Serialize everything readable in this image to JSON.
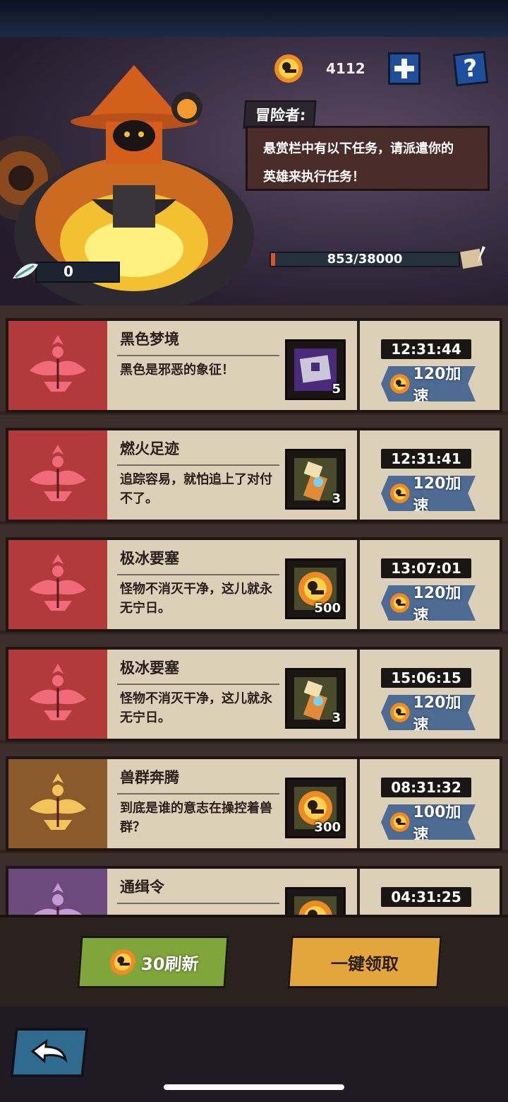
{
  "header": {
    "currency": {
      "icon": "gold-coin-icon",
      "value": "4112"
    },
    "plus_icon": "plus-icon",
    "help_label": "?"
  },
  "npc": {
    "name": "冒险者:",
    "line1": "悬赏栏中有以下任务，请派遣你的",
    "line2": "英雄来执行任务！"
  },
  "progress": {
    "text": "853/38000",
    "fraction": 0.022
  },
  "counter": {
    "icon": "feather-icon",
    "value": "0"
  },
  "tasks": [
    {
      "title": "黑色梦境",
      "desc": "黑色是邪恶的象征！",
      "reward_icon": "purple-box-icon",
      "reward_count": "5",
      "timer": "12:31:44",
      "speed_label": "120加速",
      "tier": "red"
    },
    {
      "title": "燃火足迹",
      "desc": "追踪容易，就怕追上了对付不了。",
      "reward_icon": "scroll-key-icon",
      "reward_count": "3",
      "timer": "12:31:41",
      "speed_label": "120加速",
      "tier": "red"
    },
    {
      "title": "极冰要塞",
      "desc": "怪物不消灭干净，这儿就永无宁日。",
      "reward_icon": "gold-coin-icon",
      "reward_count": "500",
      "timer": "13:07:01",
      "speed_label": "120加速",
      "tier": "red"
    },
    {
      "title": "极冰要塞",
      "desc": "怪物不消灭干净，这儿就永无宁日。",
      "reward_icon": "scroll-key-icon",
      "reward_count": "3",
      "timer": "15:06:15",
      "speed_label": "120加速",
      "tier": "red"
    },
    {
      "title": "兽群奔腾",
      "desc": "到底是谁的意志在操控着兽群？",
      "reward_icon": "gold-coin-icon",
      "reward_count": "300",
      "timer": "08:31:32",
      "speed_label": "100加速",
      "tier": "gold"
    },
    {
      "title": "通缉令",
      "desc": "",
      "reward_icon": "gold-coin-icon",
      "reward_count": "",
      "timer": "04:31:25",
      "speed_label": "",
      "tier": "purple"
    }
  ],
  "actions": {
    "refresh_label": "30刷新",
    "claim_label": "一键领取"
  },
  "colors": {
    "tier_red": "#b23a3a",
    "tier_gold": "#8a5a2c",
    "tier_purple": "#6c4a7c",
    "speed_button": "#4d6b93",
    "refresh_button": "#7fa53b",
    "claim_button": "#e2a63a"
  },
  "footer": {
    "back_icon": "back-arrow-icon"
  }
}
